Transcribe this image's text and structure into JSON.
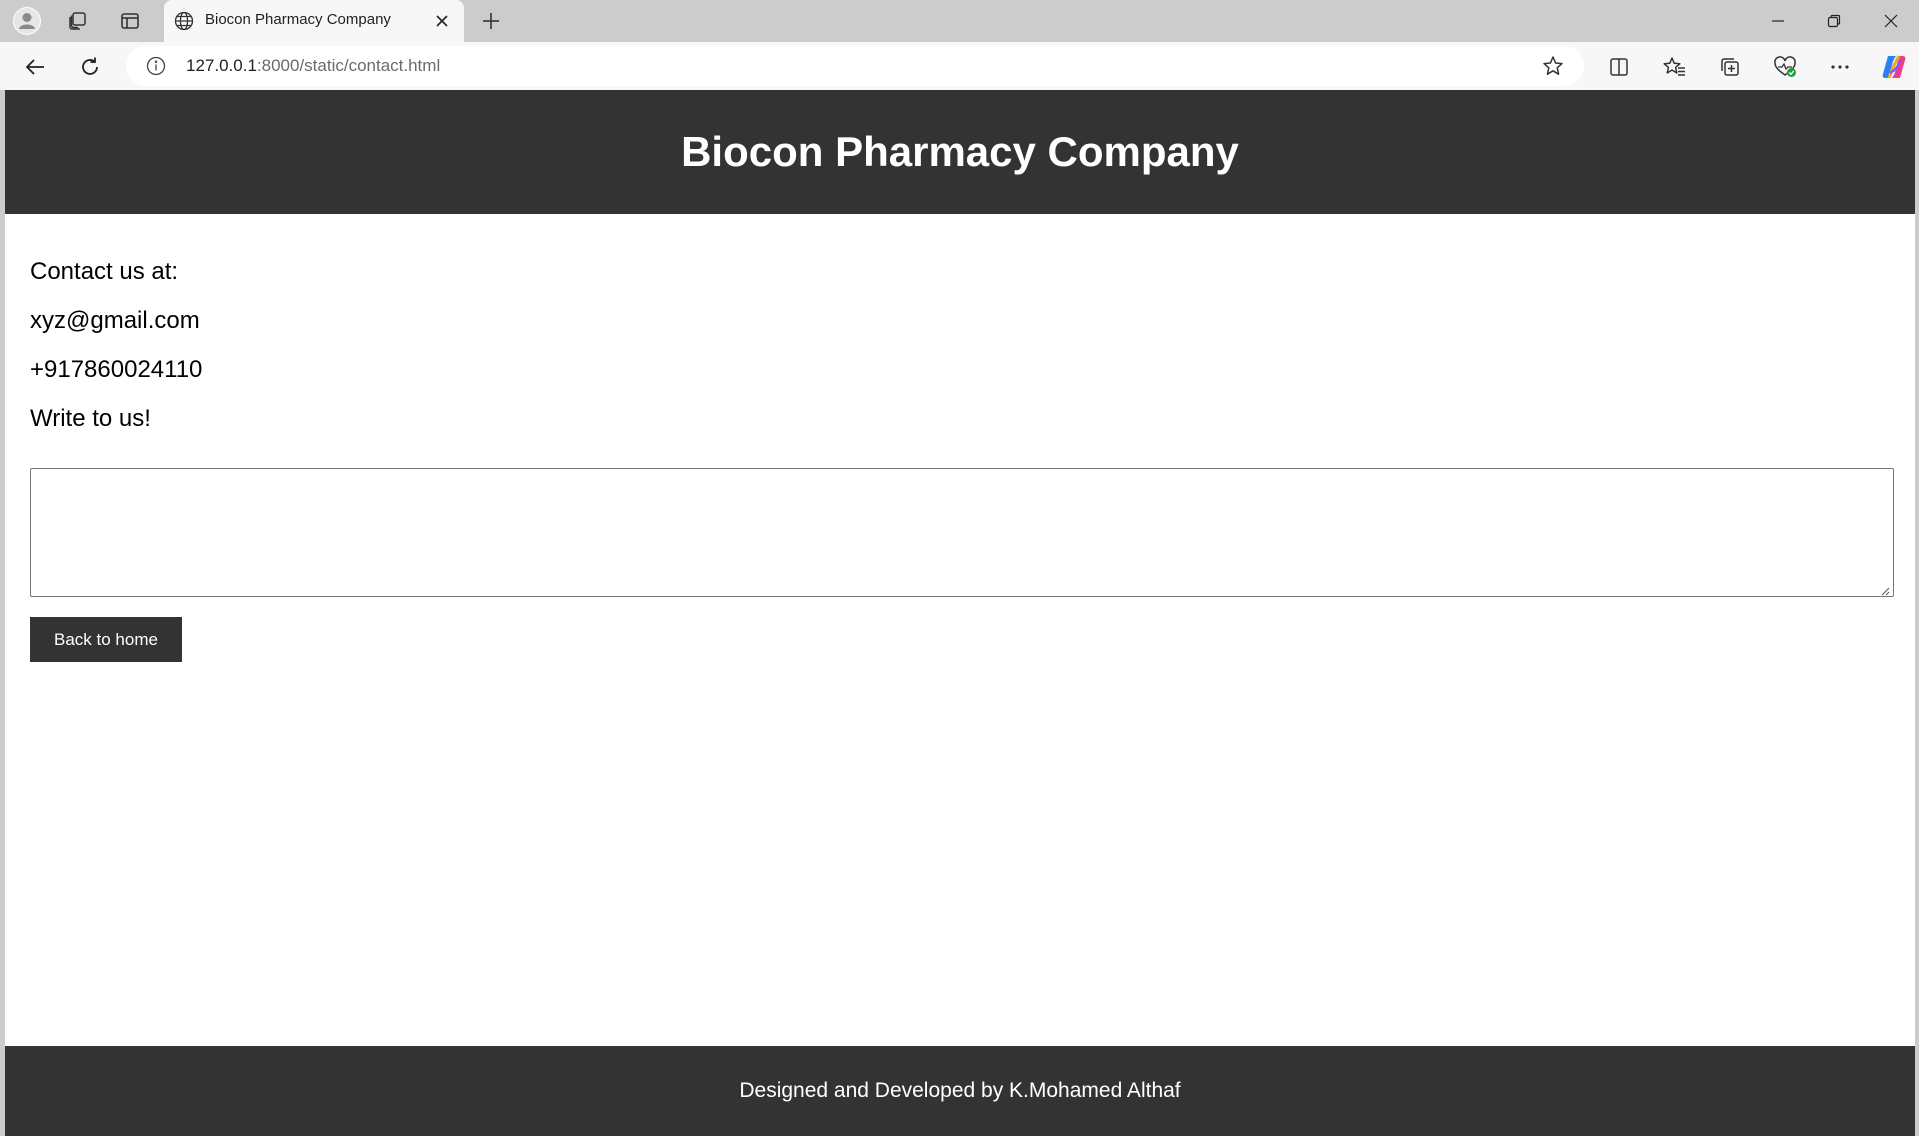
{
  "browser": {
    "tab": {
      "title": "Biocon Pharmacy Company",
      "icon": "globe-icon"
    },
    "address": {
      "host": "127.0.0.1",
      "path": ":8000/static/contact.html"
    },
    "toolbar_icons": [
      "split-screen-icon",
      "favorites-icon",
      "collections-icon",
      "browser-essentials-icon",
      "more-icon",
      "copilot-icon"
    ],
    "window_controls": [
      "minimize-icon",
      "restore-icon",
      "close-icon"
    ]
  },
  "page": {
    "header": {
      "title": "Biocon Pharmacy Company",
      "background": "#333333"
    },
    "contact": {
      "intro": "Contact us at:",
      "email": "xyz@gmail.com",
      "phone": "+917860024110",
      "prompt": "Write to us!"
    },
    "message": {
      "value": ""
    },
    "home_button": {
      "label": "Back to home"
    },
    "footer": {
      "text": "Designed and Developed by K.Mohamed Althaf"
    }
  }
}
